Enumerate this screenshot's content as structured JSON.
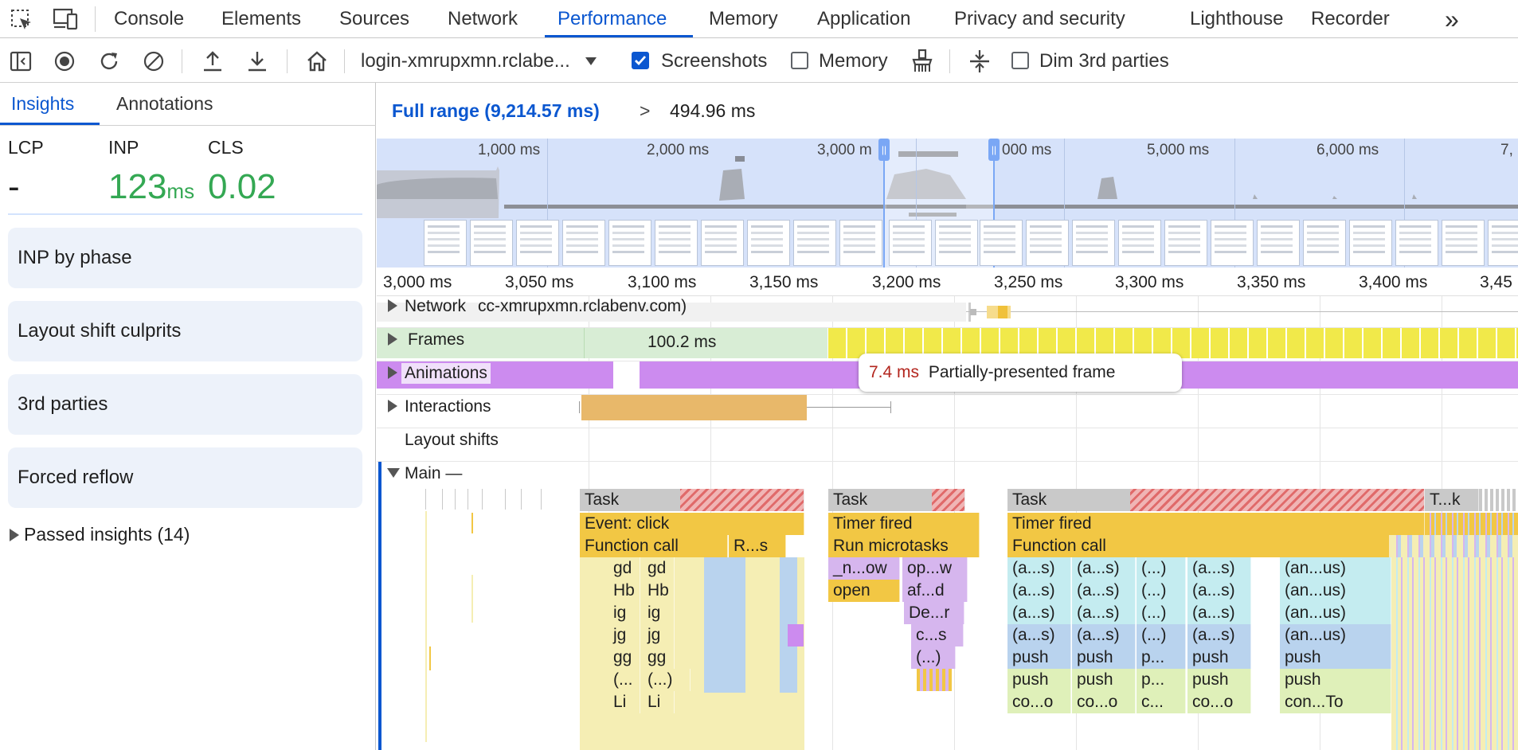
{
  "tabs": {
    "items": [
      "Console",
      "Elements",
      "Sources",
      "Network",
      "Performance",
      "Memory",
      "Application",
      "Privacy and security",
      "Lighthouse",
      "Recorder"
    ],
    "active": "Performance",
    "more": "»"
  },
  "toolbar": {
    "url": "login-xmrupxmn.rclabe...",
    "screenshots_label": "Screenshots",
    "screenshots_checked": true,
    "memory_label": "Memory",
    "memory_checked": false,
    "dim_label": "Dim 3rd parties",
    "dim_checked": false
  },
  "sidebar": {
    "tabs": [
      "Insights",
      "Annotations"
    ],
    "active_tab": "Insights",
    "metrics": [
      {
        "label": "LCP",
        "value": "-",
        "unit": ""
      },
      {
        "label": "INP",
        "value": "123",
        "unit": "ms"
      },
      {
        "label": "CLS",
        "value": "0.02",
        "unit": ""
      }
    ],
    "cards": [
      "INP by phase",
      "Layout shift culprits",
      "3rd parties",
      "Forced reflow"
    ],
    "passed": "Passed insights (14)",
    "metric_good_color": "#34a853"
  },
  "breadcrumb": {
    "full_range": "Full range (9,214.57 ms)",
    "separator": ">",
    "current": "494.96 ms"
  },
  "overview": {
    "ticks": [
      "1,000 ms",
      "2,000 ms",
      "3,000 m",
      "000 ms",
      "5,000 ms",
      "6,000 ms",
      "7,"
    ]
  },
  "ruler": {
    "ticks": [
      "3,000 ms",
      "3,050 ms",
      "3,100 ms",
      "3,150 ms",
      "3,200 ms",
      "3,250 ms",
      "3,300 ms",
      "3,350 ms",
      "3,400 ms",
      "3,45"
    ]
  },
  "tracks": {
    "network": "Network",
    "network_host": "cc-xmrupxmn.rclabenv.com)",
    "frames": "Frames",
    "frames_duration": "100.2 ms",
    "animations": "Animations",
    "interactions": "Interactions",
    "layout_shifts": "Layout shifts",
    "main": "Main —"
  },
  "tooltip": {
    "time": "7.4 ms",
    "text": "Partially-presented frame"
  },
  "flame": {
    "row1": [
      "Task",
      "Task",
      "Task",
      "T...k"
    ],
    "row2": [
      "Event: click",
      "Timer fired",
      "Timer fired"
    ],
    "row3": [
      "Function call",
      "R...s",
      "Run microtasks",
      "Function call"
    ],
    "row4": [
      "gd",
      "gd",
      "_n...ow",
      "op...w",
      "(a...s)",
      "(a...s)",
      "(...)",
      "(a...s)",
      "(an...us)"
    ],
    "row5": [
      "Hb",
      "Hb",
      "open",
      "af...d",
      "(a...s)",
      "(a...s)",
      "(...)",
      "(a...s)",
      "(an...us)"
    ],
    "row6": [
      "ig",
      "ig",
      "De...r",
      "(a...s)",
      "(a...s)",
      "(...)",
      "(a...s)",
      "(an...us)"
    ],
    "row7": [
      "jg",
      "jg",
      "c...s",
      "(a...s)",
      "(a...s)",
      "(...)",
      "(a...s)",
      "(an...us)"
    ],
    "row8": [
      "gg",
      "gg",
      "(...)",
      "push",
      "push",
      "p...",
      "push",
      "push"
    ],
    "row9": [
      "(...",
      "(...)",
      "push",
      "push",
      "p...",
      "push",
      "push"
    ],
    "row10": [
      "Li",
      "Li",
      "co...o",
      "co...o",
      "c...",
      "co...o",
      "con...To"
    ]
  },
  "colors": {
    "accent": "#0b57d0",
    "task": "#c9c9c9",
    "event": "#f2c744",
    "frames_bg": "#d8edd5",
    "frames_partial": "#f1e94a",
    "animations": "#cc8bef",
    "interactions": "#e8b86a",
    "light_yellow": "#f5eeb4",
    "cyan": "#c4ecf0",
    "blue": "#b9d3ee",
    "purple": "#d6b6ee",
    "green": "#dff0b9",
    "inp_red": "#b3261e"
  }
}
